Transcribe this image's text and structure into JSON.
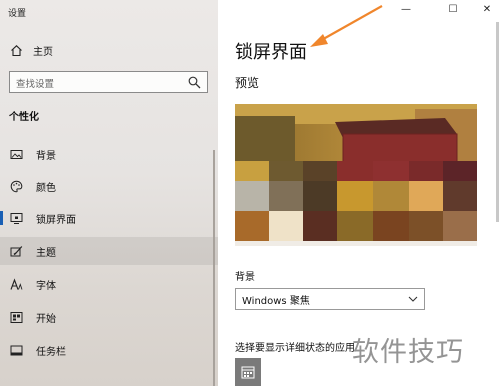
{
  "window": {
    "title": "设置",
    "minimize_glyph": "—",
    "maximize_glyph": "☐",
    "close_glyph": "✕"
  },
  "sidebar": {
    "home_label": "主页",
    "search_placeholder": "查找设置",
    "section_title": "个性化",
    "items": [
      {
        "label": "背景",
        "icon": "image-icon"
      },
      {
        "label": "颜色",
        "icon": "palette-icon"
      },
      {
        "label": "锁屏界面",
        "icon": "lock-screen-icon",
        "selected": true
      },
      {
        "label": "主题",
        "icon": "theme-brush-icon",
        "hover": true
      },
      {
        "label": "字体",
        "icon": "font-icon"
      },
      {
        "label": "开始",
        "icon": "start-icon"
      },
      {
        "label": "任务栏",
        "icon": "taskbar-icon"
      }
    ]
  },
  "main": {
    "page_title": "锁屏界面",
    "preview_label": "预览",
    "background_label": "背景",
    "background_value": "Windows 聚焦",
    "detail_label": "选择要显示详细状态的应用"
  },
  "watermark": "软件技巧",
  "colors": {
    "accent": "#1a5fb4",
    "annotation_arrow": "#f0862c"
  }
}
